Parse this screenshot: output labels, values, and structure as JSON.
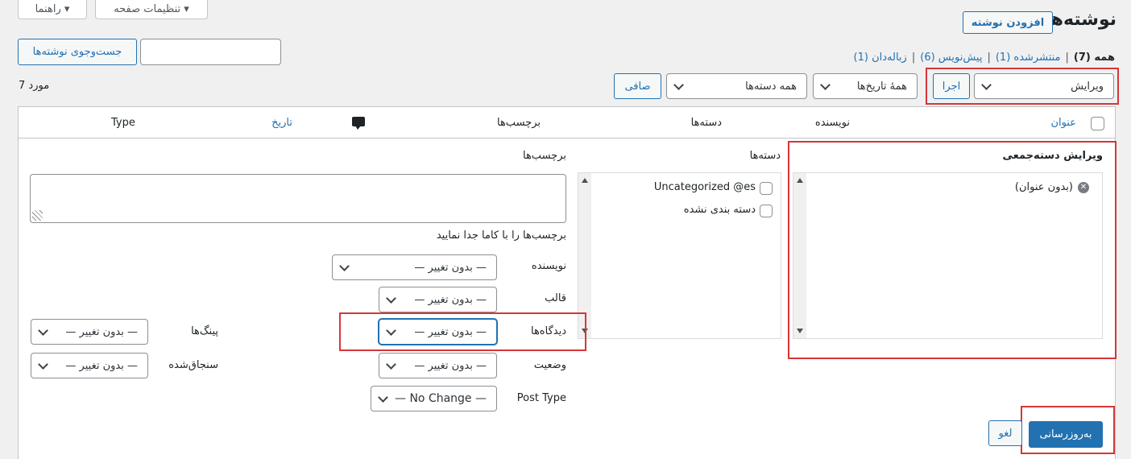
{
  "top_buttons": {
    "help": "راهنما ▾",
    "screen_options": "تنظیمات صفحه ▾"
  },
  "header": {
    "title": "نوشته‌ها",
    "add_new": "افزودن نوشته"
  },
  "search": {
    "button": "جست‌وجوی نوشته‌ها",
    "value": ""
  },
  "views": {
    "all": "همه (7)",
    "published": "منتشرشده (1)",
    "drafts": "پیش‌نویس (6)",
    "trash": "زباله‌دان (1)",
    "sep": "|"
  },
  "toolbar": {
    "bulk_action": "ویرایش",
    "apply": "اجرا",
    "dates": "همهٔ تاریخ‌ها",
    "categories": "همه دسته‌ها",
    "filter": "صافی",
    "items_count": "7 مورد"
  },
  "table_header": {
    "title": "عنوان",
    "author": "نویسنده",
    "categories": "دسته‌ها",
    "tags": "برچسب‌ها",
    "date": "تاریخ",
    "type": "Type"
  },
  "bulk_edit": {
    "heading": "ویرایش دسته‌جمعی",
    "post_item": "(بدون عنوان)",
    "categories_label": "دسته‌ها",
    "category_items": [
      "Uncategorized @es",
      "دسته بندی نشده"
    ],
    "tags_label": "برچسب‌ها",
    "tags_hint": "برچسب‌ها را با کاما جدا نمایید",
    "author_label": "نویسنده",
    "template_label": "قالب",
    "comments_label": "دیدگاه‌ها",
    "status_label": "وضعیت",
    "post_type_label": "Post Type",
    "pings_label": "پینگ‌ها",
    "sticky_label": "سنجاق‌شده",
    "no_change": "— بدون تغییر —",
    "no_change_en": "— No Change —",
    "update": "به‌روزرسانی",
    "cancel": "لغو"
  },
  "colors": {
    "accent": "#2271b1",
    "highlight": "#d63638",
    "background": "#f0f0f1"
  }
}
